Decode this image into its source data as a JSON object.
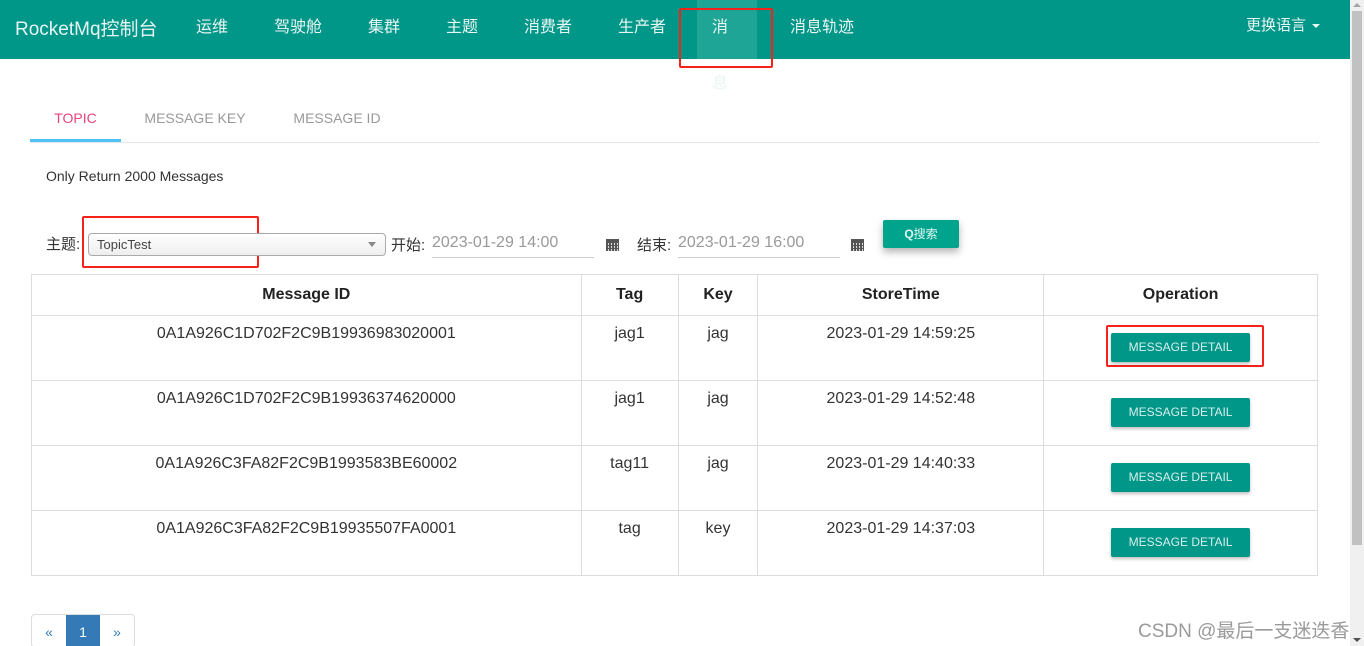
{
  "navbar": {
    "brand": "RocketMq控制台",
    "items": [
      {
        "label": "运维",
        "active": false
      },
      {
        "label": "驾驶舱",
        "active": false
      },
      {
        "label": "集群",
        "active": false
      },
      {
        "label": "主题",
        "active": false
      },
      {
        "label": "消费者",
        "active": false
      },
      {
        "label": "生产者",
        "active": false
      },
      {
        "label": "消息",
        "active": true
      },
      {
        "label": "消息轨迹",
        "active": false
      }
    ],
    "language_menu": "更换语言"
  },
  "tabs": [
    {
      "label": "TOPIC",
      "active": true
    },
    {
      "label": "MESSAGE KEY",
      "active": false
    },
    {
      "label": "MESSAGE ID",
      "active": false
    }
  ],
  "notice": "Only Return 2000 Messages",
  "filter": {
    "topic_label": "主题:",
    "topic_value": "TopicTest",
    "start_label": "开始:",
    "start_value": "2023-01-29 14:00",
    "end_label": "结束:",
    "end_value": "2023-01-29 16:00",
    "search_button": "搜索",
    "search_icon": "search-icon"
  },
  "table": {
    "headers": [
      "Message ID",
      "Tag",
      "Key",
      "StoreTime",
      "Operation"
    ],
    "rows": [
      {
        "id": "0A1A926C1D702F2C9B19936983020001",
        "tag": "jag1",
        "key": "jag",
        "store_time": "2023-01-29 14:59:25",
        "action": "MESSAGE DETAIL"
      },
      {
        "id": "0A1A926C1D702F2C9B19936374620000",
        "tag": "jag1",
        "key": "jag",
        "store_time": "2023-01-29 14:52:48",
        "action": "MESSAGE DETAIL"
      },
      {
        "id": "0A1A926C3FA82F2C9B1993583BE60002",
        "tag": "tag11",
        "key": "jag",
        "store_time": "2023-01-29 14:40:33",
        "action": "MESSAGE DETAIL"
      },
      {
        "id": "0A1A926C3FA82F2C9B19935507FA0001",
        "tag": "tag",
        "key": "key",
        "store_time": "2023-01-29 14:37:03",
        "action": "MESSAGE DETAIL"
      }
    ]
  },
  "pagination": {
    "prev": "«",
    "current": "1",
    "next": "»"
  },
  "watermark": "CSDN @最后一支迷迭香",
  "colors": {
    "primary": "#009688",
    "tab_active": "#e8447a",
    "tab_underline": "#4fc3f7",
    "annotation": "#f5221b",
    "page_active": "#337ab7"
  }
}
